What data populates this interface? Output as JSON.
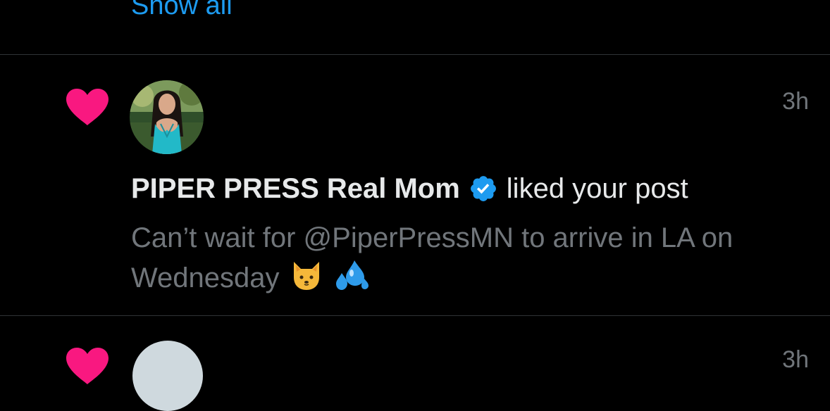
{
  "previous_section": {
    "show_all_label": "Show all"
  },
  "notification": {
    "type_icon": "heart-icon",
    "timestamp": "3h",
    "user": {
      "display_name": "PIPER PRESS Real Mom",
      "verified": true,
      "avatar": "profile-photo"
    },
    "action_text": "liked your post",
    "post_preview": "Can’t wait for @PiperPressMN to arrive in LA on Wednesday",
    "post_emojis": [
      "cat-face-emoji",
      "sweat-droplets-emoji"
    ]
  },
  "next_notification": {
    "type_icon": "heart-icon",
    "timestamp": "3h"
  },
  "colors": {
    "background": "#000000",
    "link": "#1d9bf0",
    "heart": "#f91880",
    "primary_text": "#e7e9ea",
    "secondary_text": "#71767b",
    "divider": "#2f3336",
    "verified_badge": "#1d9bf0"
  }
}
